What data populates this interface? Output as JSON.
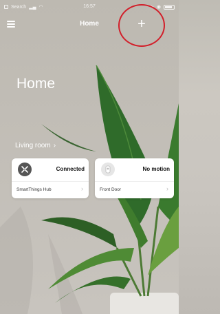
{
  "status_bar": {
    "carrier": "Search",
    "time": "16:57"
  },
  "nav": {
    "title": "Home",
    "menu_icon": "hamburger-menu-icon",
    "add_label": "+"
  },
  "page": {
    "title": "Home"
  },
  "room": {
    "label": "Living room",
    "chevron": "›"
  },
  "devices": [
    {
      "name": "SmartThings Hub",
      "status": "Connected",
      "icon": "hub-icon",
      "chevron": "›"
    },
    {
      "name": "Front Door",
      "status": "No motion",
      "icon": "motion-sensor-icon",
      "chevron": "›"
    }
  ],
  "colors": {
    "background": "#c9c5bf",
    "card": "#ffffff",
    "highlight_ring": "#d21f2a",
    "plant_green": "#2f6b2a"
  }
}
